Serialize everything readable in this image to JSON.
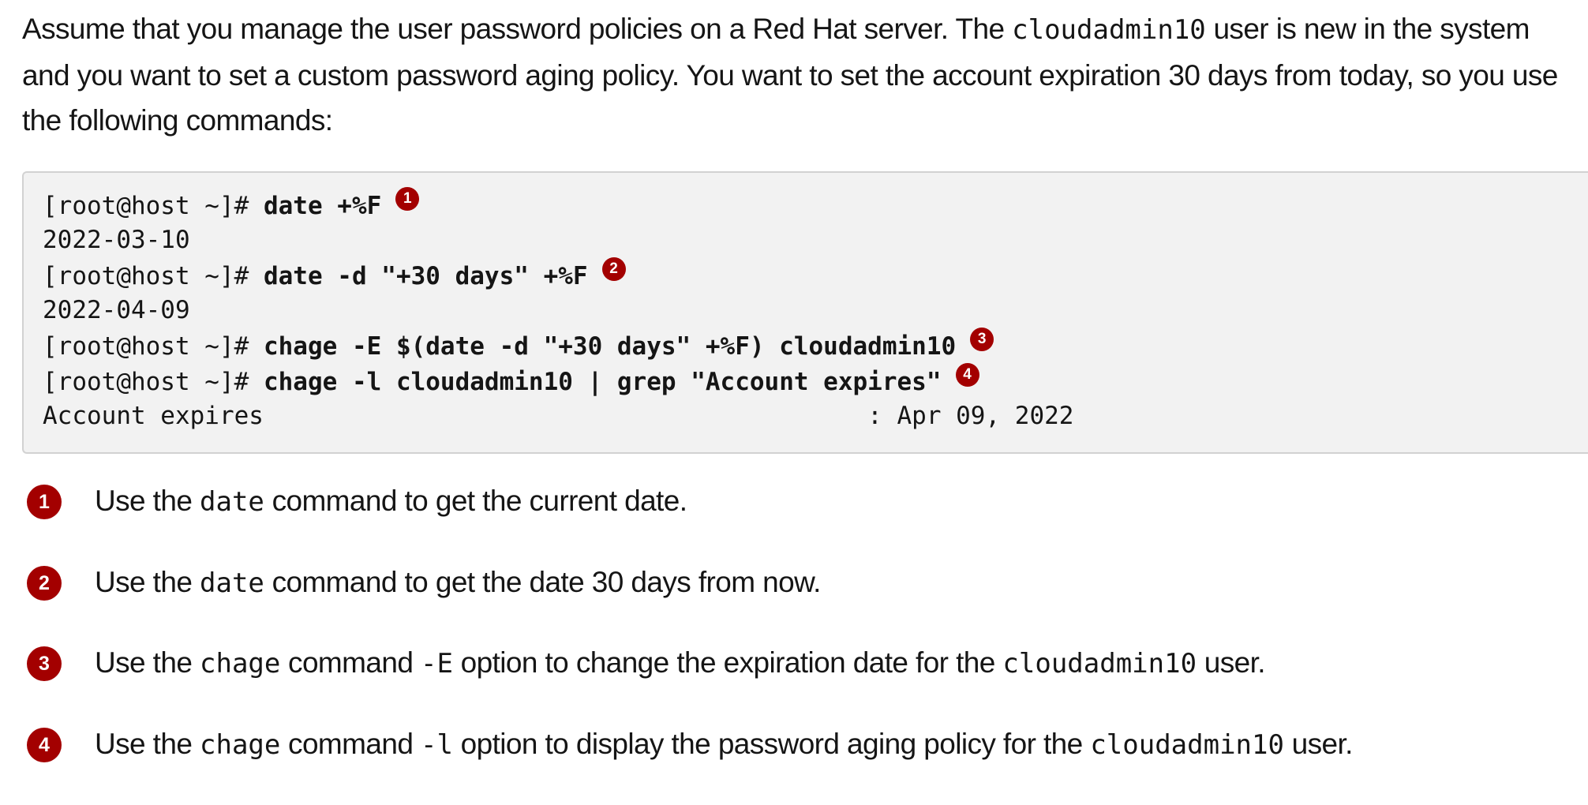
{
  "intro": {
    "part1": "Assume that you manage the user password policies on a Red Hat server. The ",
    "user": "cloudadmin10",
    "part2": " user is new in the system and you want to set a custom password aging policy. You want to set the account expiration 30 days from today, so you use the following commands:"
  },
  "code": {
    "line1": {
      "prompt": "[root@host ~]# ",
      "cmd": "date +%F",
      "callout": "1"
    },
    "line2": {
      "output": "2022-03-10"
    },
    "line3": {
      "prompt": "[root@host ~]# ",
      "cmd": "date -d \"+30 days\" +%F",
      "callout": "2"
    },
    "line4": {
      "output": "2022-04-09"
    },
    "line5": {
      "prompt": "[root@host ~]# ",
      "cmd": "chage -E $(date -d \"+30 days\" +%F) cloudadmin10",
      "callout": "3"
    },
    "line6": {
      "prompt": "[root@host ~]# ",
      "cmd": "chage -l cloudadmin10 | grep \"Account expires\"",
      "callout": "4"
    },
    "line7": {
      "output": "Account expires                                         : Apr 09, 2022"
    }
  },
  "callouts": [
    {
      "num": "1",
      "pre": "Use the ",
      "code1": "date",
      "mid": " command to get the current date.",
      "code2": "",
      "post": ""
    },
    {
      "num": "2",
      "pre": "Use the ",
      "code1": "date",
      "mid": " command to get the date 30 days from now.",
      "code2": "",
      "post": ""
    },
    {
      "num": "3",
      "pre": "Use the ",
      "code1": "chage",
      "mid": " command ",
      "opt": "-E",
      "mid2": " option to change the expiration date for the ",
      "code2": "cloudadmin10",
      "post": " user."
    },
    {
      "num": "4",
      "pre": "Use the ",
      "code1": "chage",
      "mid": " command ",
      "opt": "-l",
      "mid2": " option to display the password aging policy for the ",
      "code2": "cloudadmin10",
      "post": " user."
    }
  ],
  "colors": {
    "callout_bg": "#a30000",
    "code_bg": "#f2f2f2",
    "code_border": "#d2d2d2",
    "text": "#151515"
  }
}
